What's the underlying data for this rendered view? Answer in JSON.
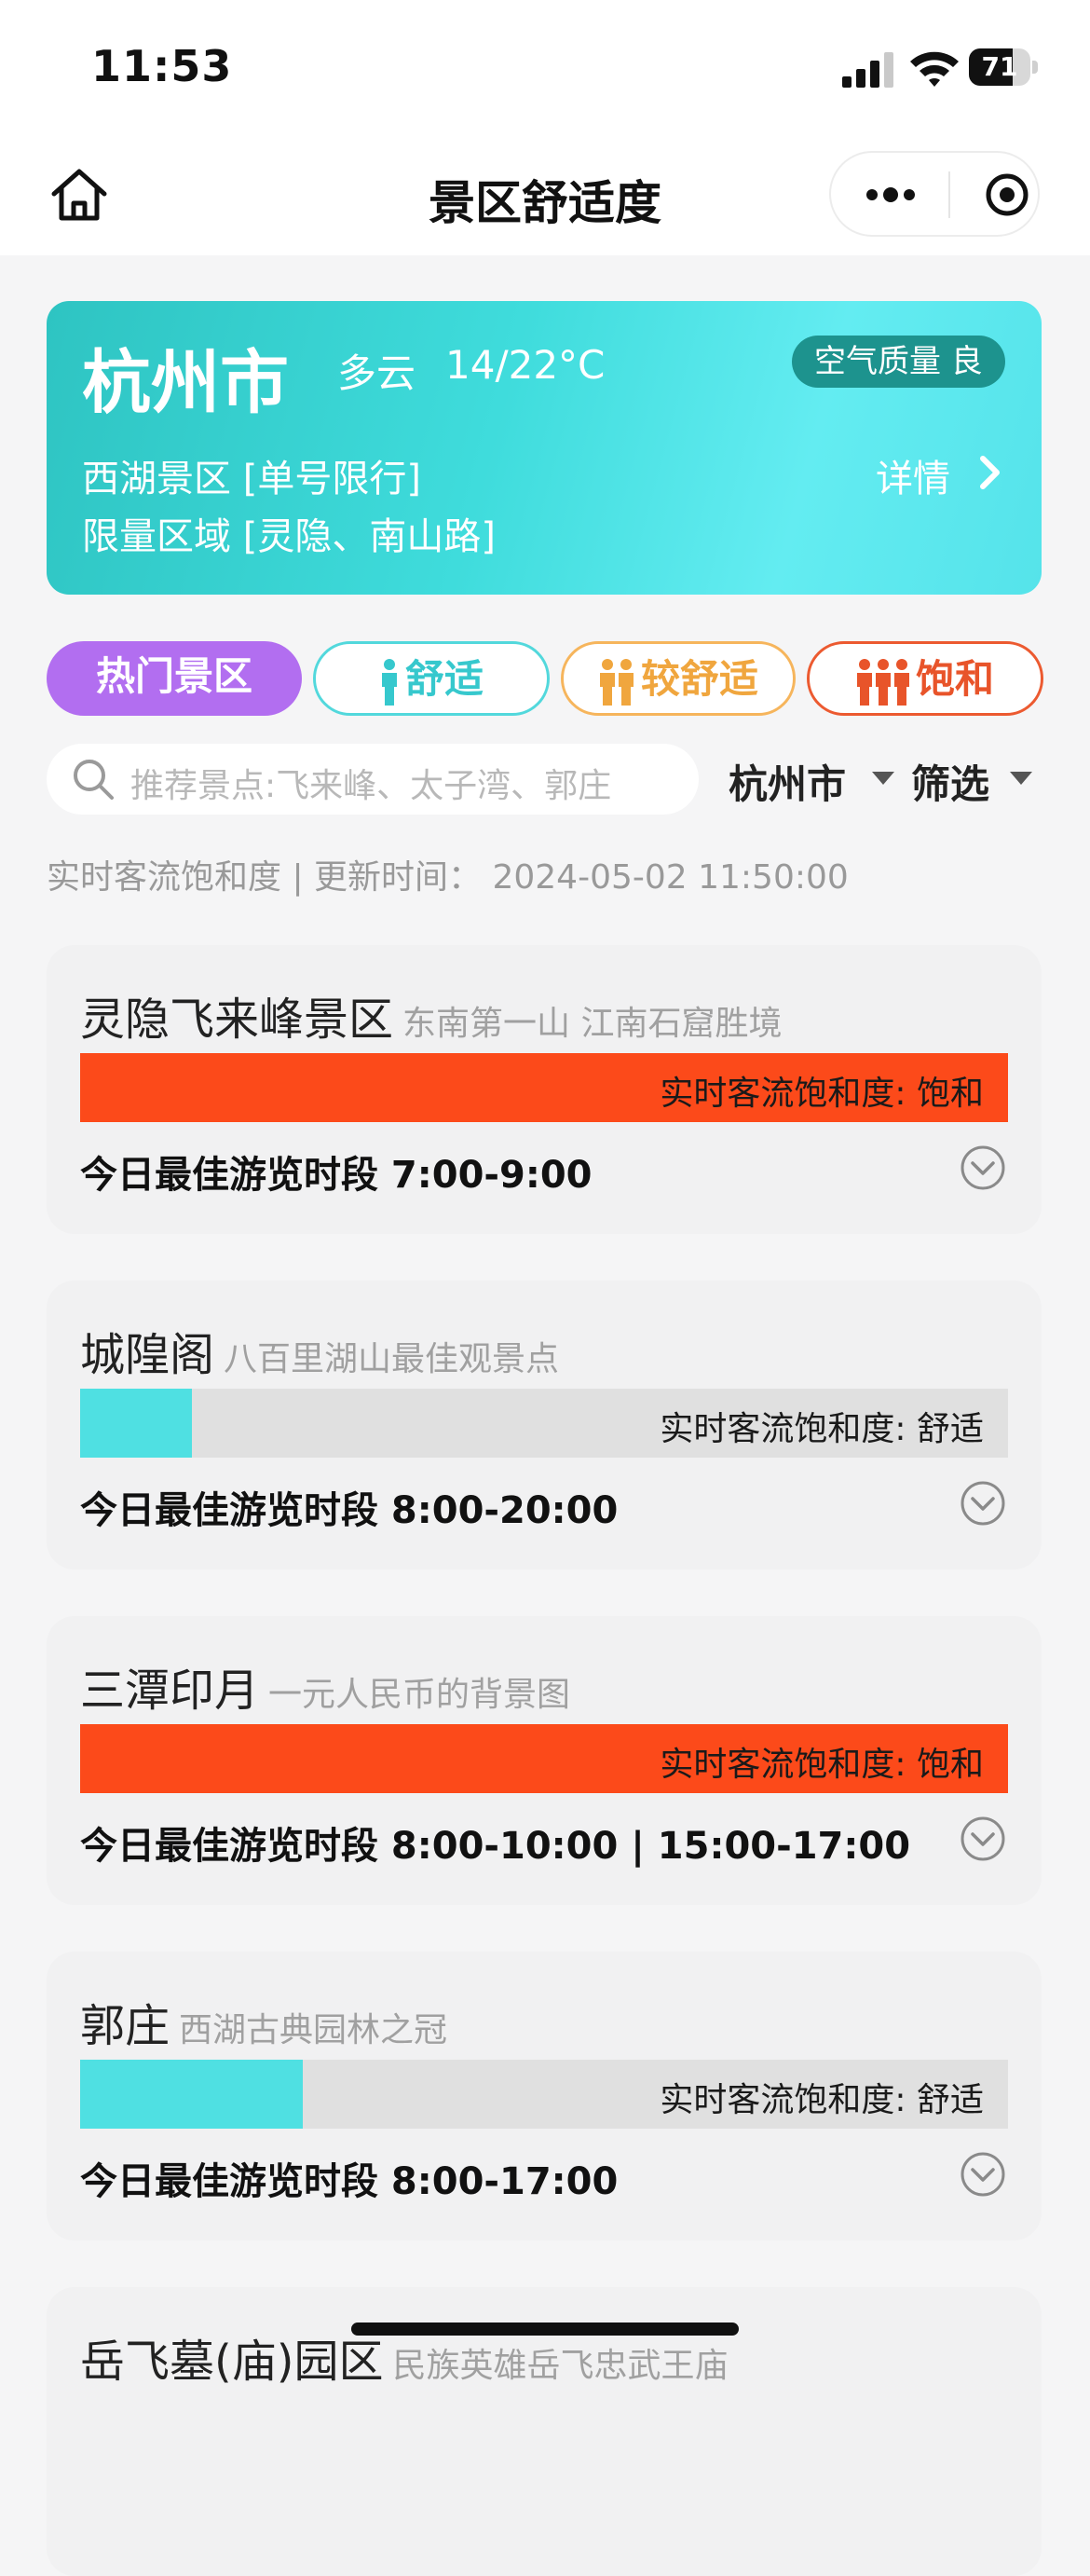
{
  "status_bar": {
    "time": "11:53",
    "battery": "71",
    "battery_level": 0.71
  },
  "nav": {
    "title": "景区舒适度"
  },
  "weather": {
    "city": "杭州市",
    "condition": "多云",
    "temp": "14/22°C",
    "aqi": "空气质量 良",
    "line1": "西湖景区 [单号限行]",
    "line2": "限量区域 [灵隐、南山路]",
    "detail": "详情"
  },
  "tabs": [
    {
      "label": "热门景区"
    },
    {
      "label": "舒适"
    },
    {
      "label": "较舒适"
    },
    {
      "label": "饱和"
    }
  ],
  "search": {
    "placeholder": "推荐景点:飞来峰、太子湾、郭庄"
  },
  "filters": {
    "city": "杭州市",
    "filter": "筛选"
  },
  "update_info": "实时客流饱和度 | 更新时间： 2024-05-02 11:50:00",
  "colors": {
    "full": "#fc4a1a",
    "comfort": "#4fe0e2",
    "hot": "#b26ef0"
  },
  "spots": [
    {
      "name": "灵隐飞来峰景区",
      "slogan": "东南第一山 江南石窟胜境",
      "status": "实时客流饱和度: 饱和",
      "level": 1.0,
      "best": "今日最佳游览时段 7:00-9:00"
    },
    {
      "name": "城隍阁",
      "slogan": "八百里湖山最佳观景点",
      "status": "实时客流饱和度: 舒适",
      "level": 0.12,
      "best": "今日最佳游览时段 8:00-20:00"
    },
    {
      "name": "三潭印月",
      "slogan": "一元人民币的背景图",
      "status": "实时客流饱和度: 饱和",
      "level": 1.0,
      "best": "今日最佳游览时段 8:00-10:00 | 15:00-17:00"
    },
    {
      "name": "郭庄",
      "slogan": "西湖古典园林之冠",
      "status": "实时客流饱和度: 舒适",
      "level": 0.24,
      "best": "今日最佳游览时段 8:00-17:00"
    },
    {
      "name": "岳飞墓(庙)园区",
      "slogan": "民族英雄岳飞忠武王庙",
      "status": "",
      "level": 0,
      "best": ""
    }
  ]
}
